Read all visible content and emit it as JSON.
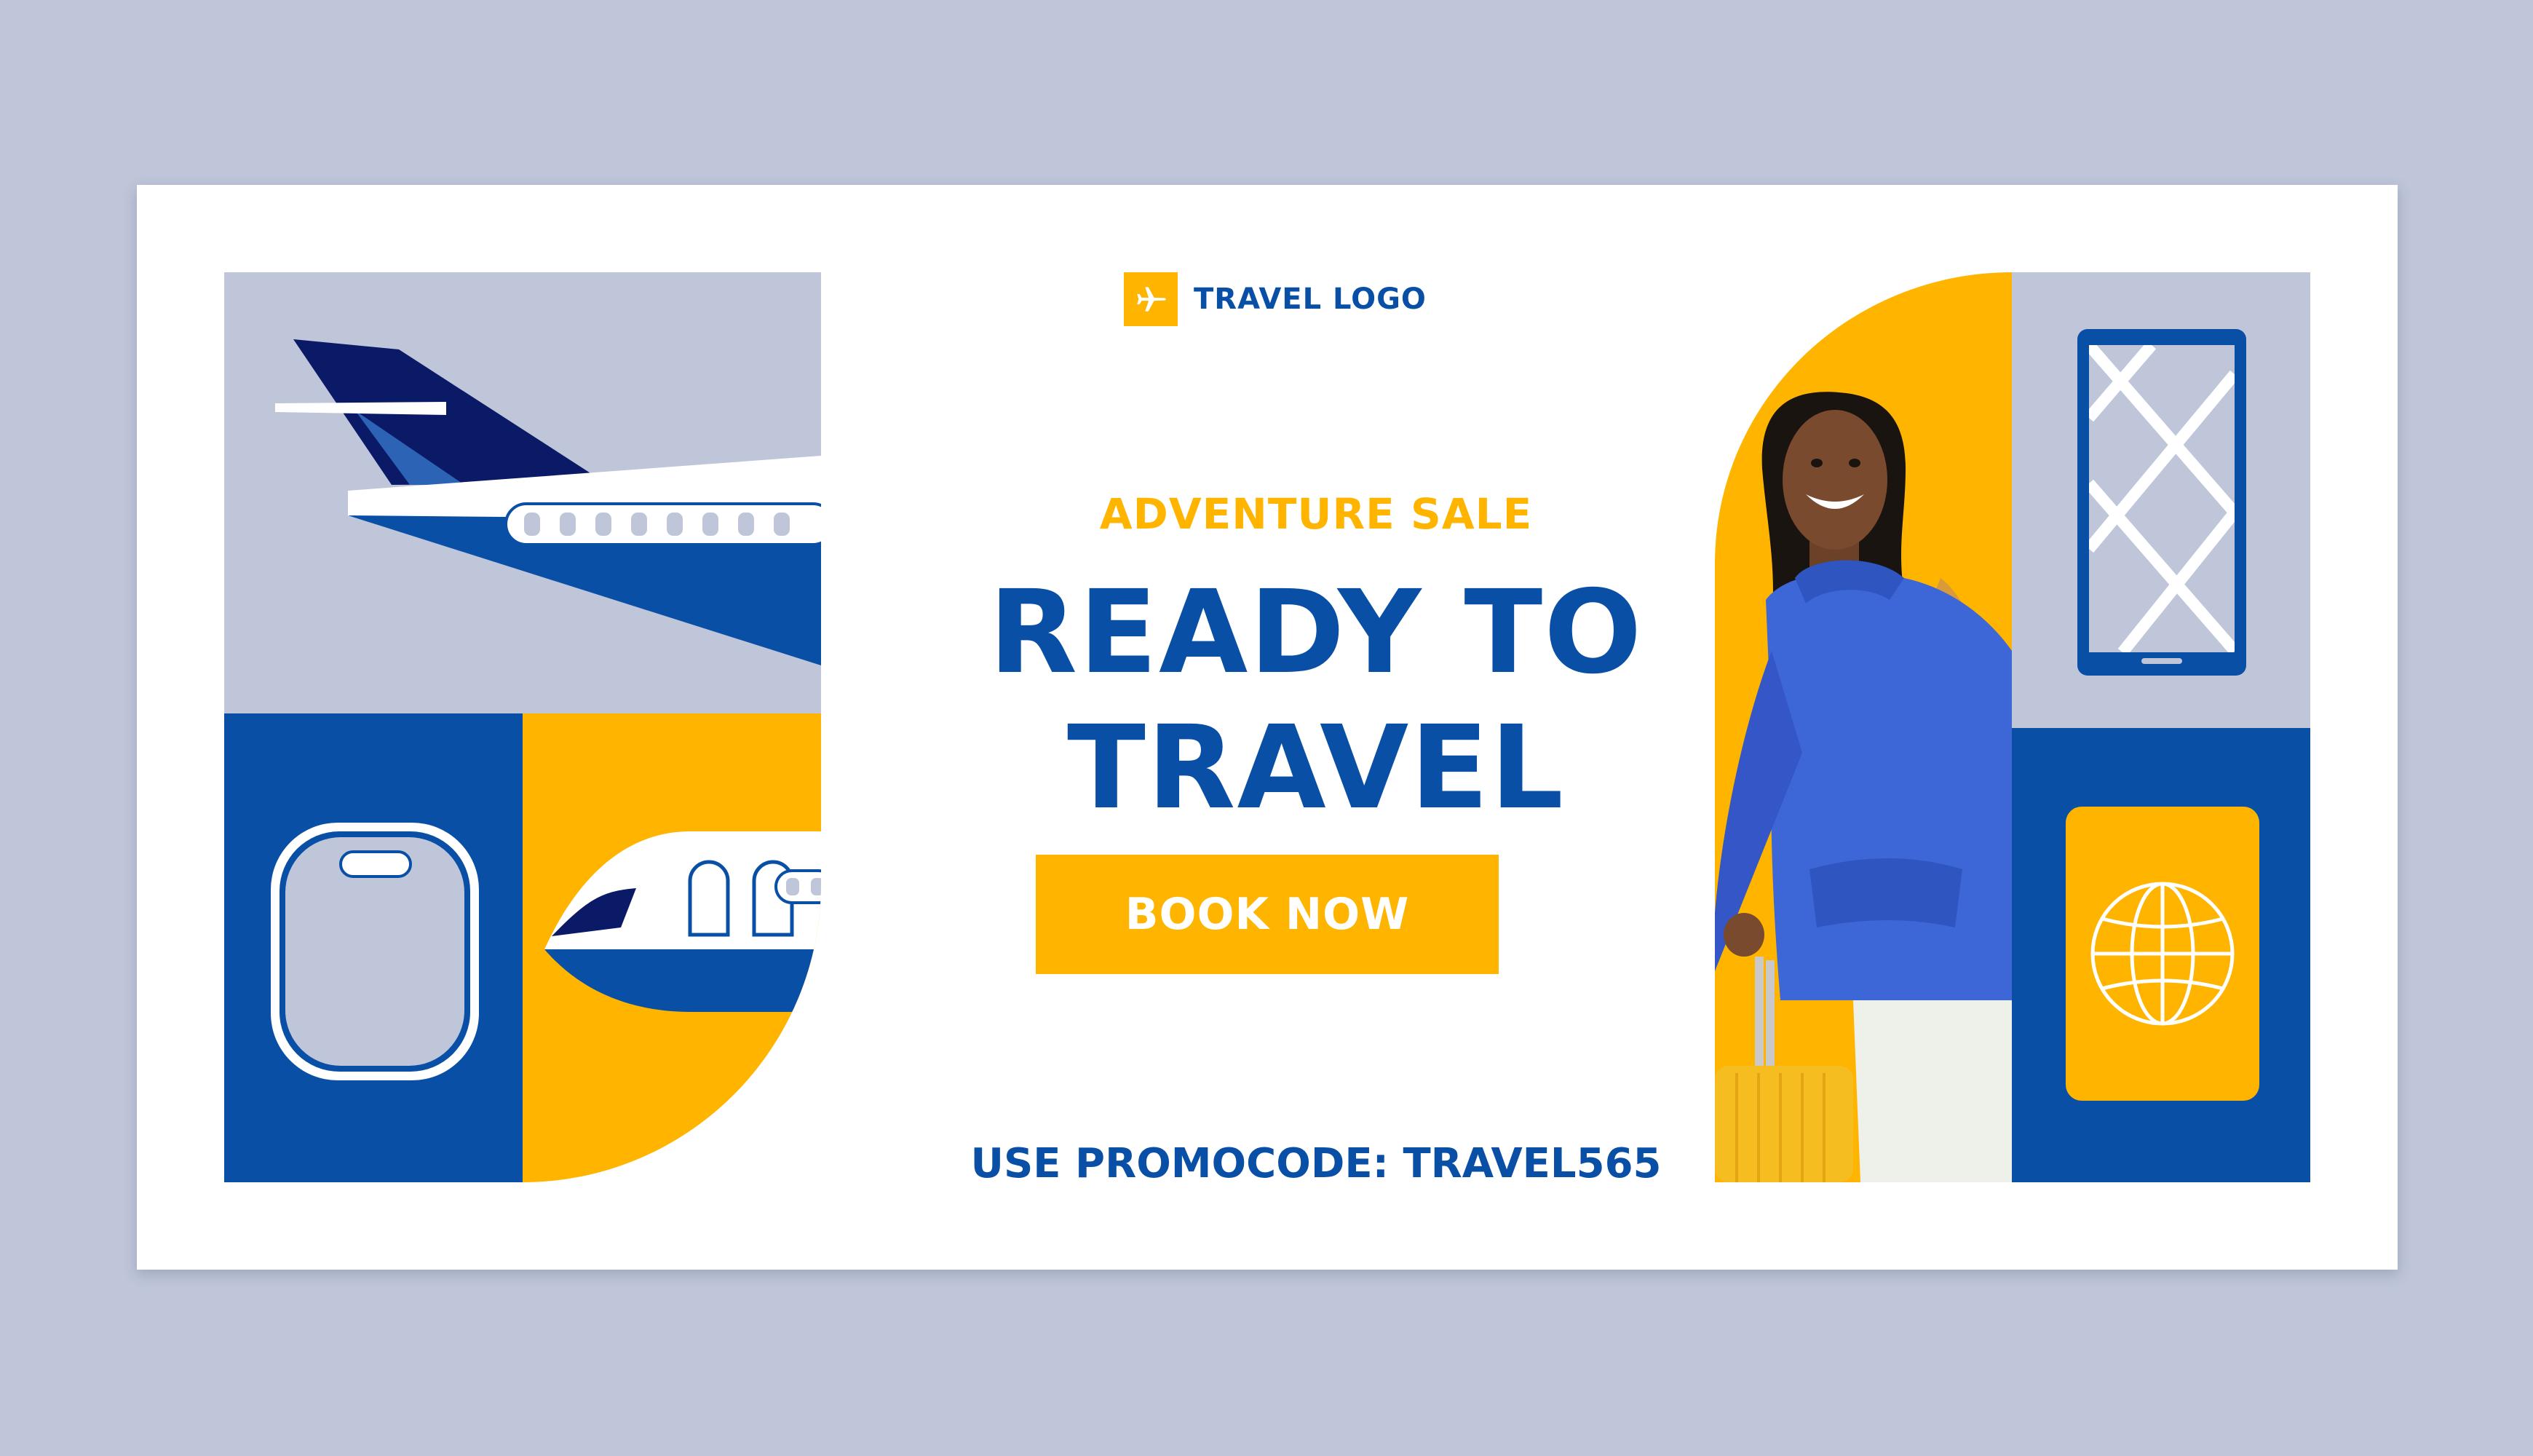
{
  "brand": {
    "logo_text": "TRAVEL LOGO",
    "logo_icon": "airplane-icon"
  },
  "hero": {
    "eyebrow": "ADVENTURE SALE",
    "headline_line1": "READY TO",
    "headline_line2": "TRAVEL",
    "cta_label": "BOOK NOW",
    "promo_text": "USE PROMOCODE: TRAVEL565"
  },
  "colors": {
    "page_background": "#bfc6d9",
    "banner_background": "#ffffff",
    "primary_blue": "#0a4fa6",
    "navy": "#0a1a66",
    "accent_yellow": "#ffb400",
    "light_gray": "#bfc6d9"
  },
  "illustrations": {
    "left": [
      "airplane-tail-icon",
      "airplane-window-icon",
      "airplane-nose-icon"
    ],
    "right": [
      "traveler-photo",
      "smartphone-map-icon",
      "passport-globe-icon"
    ]
  }
}
